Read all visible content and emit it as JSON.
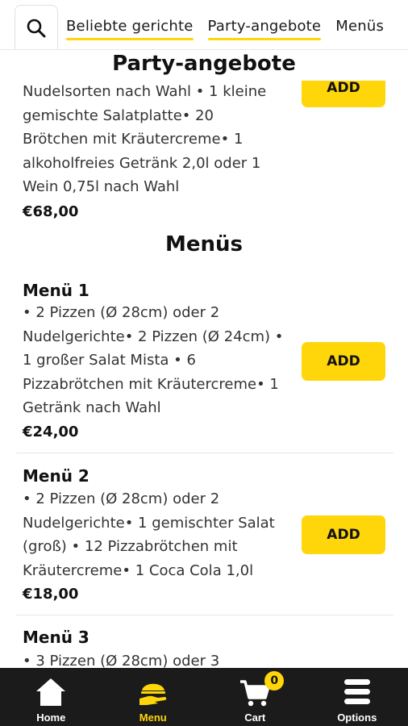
{
  "topbar": {
    "tabs": [
      {
        "label": "Beliebte gerichte"
      },
      {
        "label": "Party-angebote"
      },
      {
        "label": "Menüs"
      }
    ]
  },
  "party": {
    "title": "Party-angebote",
    "item": {
      "desc_lines": [
        "Nudelsorten nach Wahl • 1 kleine",
        "gemischte Salatplatte• 20",
        "Brötchen mit Kräutercreme• 1",
        "alkoholfreies Getränk 2,0l oder 1",
        "Wein 0,75l nach Wahl"
      ],
      "price": "€68,00",
      "add_label": "ADD"
    }
  },
  "menus": {
    "title": "Menüs",
    "items": [
      {
        "name": "Menü 1",
        "desc_lines": [
          "• 2 Pizzen (Ø 28cm) oder 2",
          "Nudelgerichte• 2 Pizzen (Ø 24cm) •",
          "1 großer Salat Mista • 6",
          "Pizzabrötchen mit Kräutercreme• 1",
          "Getränk nach Wahl"
        ],
        "price": "€24,00",
        "add_label": "ADD"
      },
      {
        "name": "Menü 2",
        "desc_lines": [
          "• 2 Pizzen (Ø 28cm) oder 2",
          "Nudelgerichte• 1 gemischter Salat",
          "(groß) • 12 Pizzabrötchen mit",
          "Kräutercreme• 1 Coca Cola 1,0l"
        ],
        "price": "€18,00",
        "add_label": "ADD"
      },
      {
        "name": "Menü 3",
        "desc_lines": [
          "• 3 Pizzen (Ø 28cm) oder 3"
        ]
      }
    ]
  },
  "bottomnav": {
    "items": [
      {
        "label": "Home",
        "icon": "home-icon"
      },
      {
        "label": "Menu",
        "icon": "menu-hand-icon"
      },
      {
        "label": "Cart",
        "icon": "cart-icon",
        "badge": "0"
      },
      {
        "label": "Options",
        "icon": "hamburger-icon"
      }
    ]
  },
  "colors": {
    "accent": "#ffd60a",
    "nav_bg": "#1b1b1b",
    "text": "#1a1a1a"
  }
}
